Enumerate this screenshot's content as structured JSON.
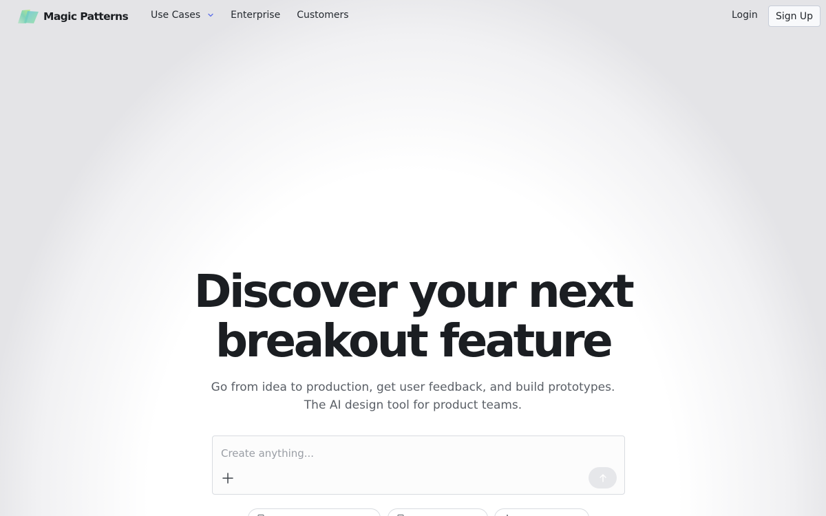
{
  "brand": {
    "name": "Magic Patterns",
    "logo_icon": "brand-logo-icon",
    "logo_colors": [
      "#8fd6a8",
      "#5ec2d6",
      "#b9ec7a"
    ]
  },
  "nav": {
    "items": [
      {
        "label": "Use Cases",
        "icon": "chevron-down-icon"
      },
      {
        "label": "Enterprise"
      },
      {
        "label": "Customers"
      }
    ],
    "login_label": "Login",
    "signup_label": "Sign Up"
  },
  "hero": {
    "headline_line1": "Discover your next",
    "headline_line2": "breakout feature",
    "subtitle_line1": "Go from idea to production, get user feedback, and build prototypes.",
    "subtitle_line2": "The AI design tool for product teams."
  },
  "prompt": {
    "placeholder": "Create anything...",
    "value": "",
    "attach_icon": "plus-icon",
    "send_icon": "arrow-up-icon"
  },
  "chips": [
    {
      "icon": "document-icon",
      "label": ""
    },
    {
      "icon": "document-icon",
      "label": ""
    },
    {
      "icon": "sparkle-icon",
      "label": ""
    }
  ],
  "colors": {
    "text_primary": "#1b1e22",
    "text_secondary": "#5a5f66",
    "signup_border": "#c7cdd8",
    "send_bg": "#e6e7ea"
  }
}
